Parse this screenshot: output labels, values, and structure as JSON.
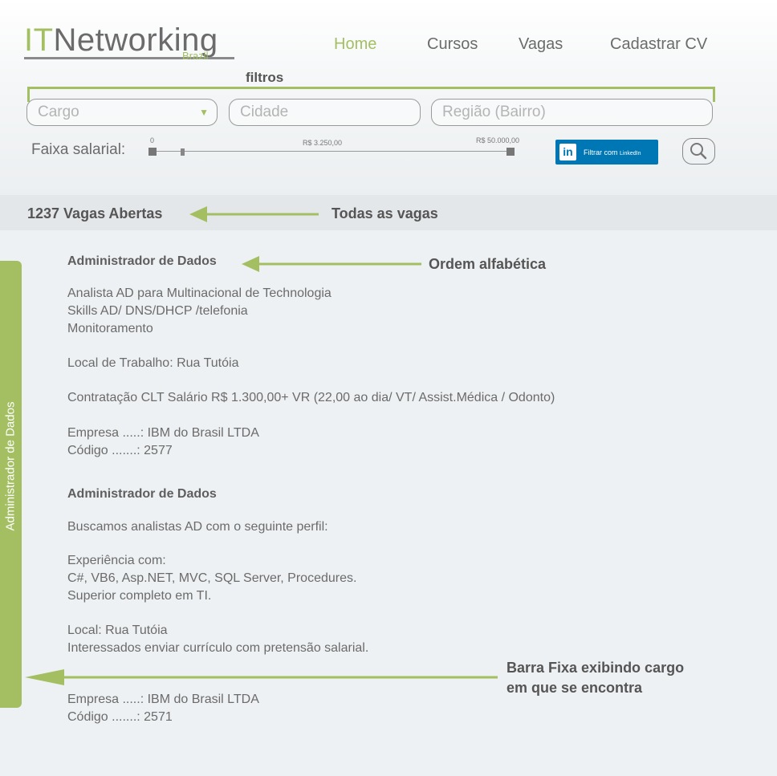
{
  "brand": {
    "it": "IT",
    "name": "Networking",
    "sub": "Brazil"
  },
  "nav": {
    "home": "Home",
    "cursos": "Cursos",
    "vagas": "Vagas",
    "cadastrar": "Cadastrar CV"
  },
  "filters": {
    "label": "filtros",
    "cargo_placeholder": "Cargo",
    "cidade_placeholder": "Cidade",
    "regiao_placeholder": "Região (Bairro)",
    "salary_label": "Faixa salarial:",
    "salary_min": "0",
    "salary_mid": "R$ 3.250,00",
    "salary_max": "R$ 50.000,00",
    "linkedin_logo": "in",
    "linkedin_text": "Filtrar com",
    "linkedin_brand": "LinkedIn"
  },
  "summary": {
    "count": "1237 Vagas Abertas"
  },
  "annotations": {
    "todas": "Todas as vagas",
    "ordem": "Ordem alfabética",
    "barra_1": "Barra Fixa exibindo cargo",
    "barra_2": "em que se encontra"
  },
  "sidebar": {
    "label": "Administrador de Dados"
  },
  "jobs": [
    {
      "title": "Administrador de Dados",
      "lines": [
        "Analista AD para Multinacional de Technologia",
        "Skills AD/ DNS/DHCP /telefonia",
        "Monitoramento",
        "Local de Trabalho: Rua Tutóia",
        "Contratação CLT Salário R$ 1.300,00+ VR (22,00 ao dia/ VT/ Assist.Médica / Odonto)",
        "Empresa .....: IBM do Brasil LTDA",
        "Código .......: 2577"
      ]
    },
    {
      "title": "Administrador de Dados",
      "lines": [
        "Buscamos analistas AD com o seguinte perfil:",
        "Experiência com:",
        "C#, VB6, Asp.NET, MVC, SQL Server, Procedures.",
        "Superior completo em TI.",
        "Local: Rua Tutóia",
        "Interessados enviar currículo com pretensão salarial.",
        "Empresa .....: IBM do Brasil LTDA",
        "Código .......: 2571"
      ]
    }
  ],
  "colors": {
    "accent": "#a3bf62",
    "linkedin": "#0077b5",
    "text": "#6b6b6b"
  },
  "icons": [
    "search-icon",
    "linkedin-icon",
    "chevron-down-icon",
    "arrow-left-icon"
  ]
}
